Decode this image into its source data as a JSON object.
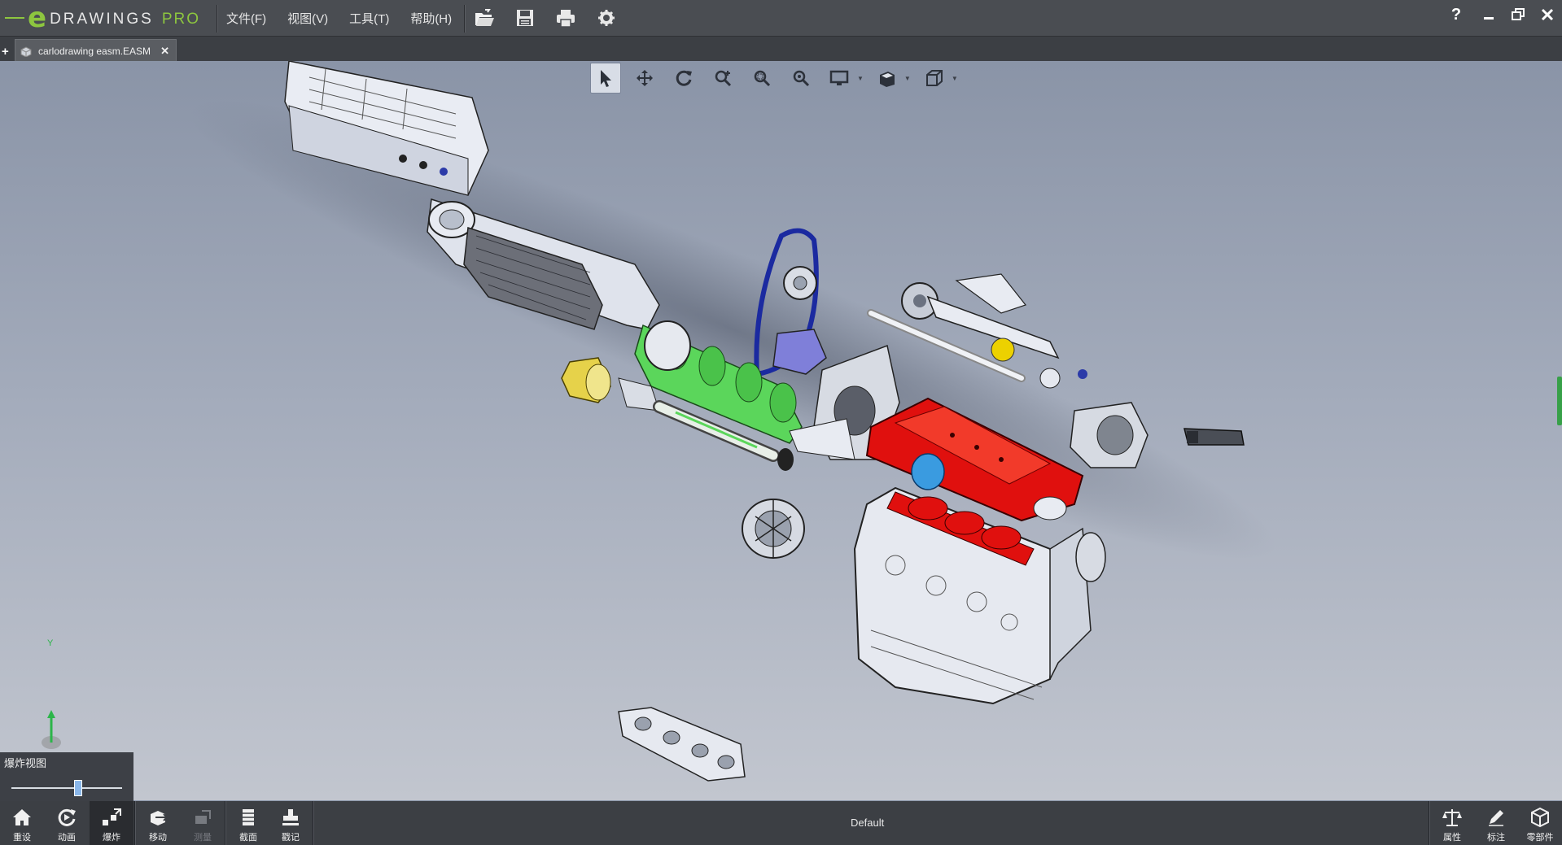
{
  "app": {
    "logo_text": "DRAWINGS",
    "logo_suffix": "PRO",
    "logo_e": "e"
  },
  "menu": {
    "items": [
      "文件(F)",
      "视图(V)",
      "工具(T)",
      "帮助(H)"
    ]
  },
  "toolbar": {
    "icons": [
      "open-folder-icon",
      "save-icon",
      "print-icon",
      "settings-gear-icon"
    ]
  },
  "window": {
    "help_label": "?"
  },
  "tabs": {
    "add_label": "+",
    "document": "carlodrawing easm.EASM",
    "close_label": "✕"
  },
  "viewport_tools": [
    "select",
    "pan",
    "rotate",
    "zoom-to-fit",
    "zoom-to-area",
    "zoom",
    "display-style",
    "shaded",
    "standard-views"
  ],
  "explode_panel": {
    "title": "爆炸视图",
    "level": 0.6
  },
  "axis": {
    "y_label": "Y"
  },
  "bottom": {
    "buttons": [
      {
        "label": "重设",
        "icon": "home-icon",
        "enabled": true
      },
      {
        "label": "动画",
        "icon": "animate-icon",
        "enabled": true
      },
      {
        "label": "爆炸",
        "icon": "explode-icon",
        "enabled": true,
        "active": true
      },
      {
        "label": "移动",
        "icon": "move-icon",
        "enabled": true
      },
      {
        "label": "测量",
        "icon": "measure-icon",
        "enabled": false
      },
      {
        "label": "截面",
        "icon": "section-icon",
        "enabled": true
      },
      {
        "label": "戳记",
        "icon": "stamp-icon",
        "enabled": true
      }
    ],
    "config_label": "Default",
    "right_buttons": [
      {
        "label": "属性",
        "icon": "properties-scale-icon"
      },
      {
        "label": "标注",
        "icon": "markup-pencil-icon"
      },
      {
        "label": "零部件",
        "icon": "components-icon"
      }
    ]
  },
  "colors": {
    "accent": "#8dc63f",
    "valve_cover": "#e0100e",
    "crankshaft": "#5bd65b",
    "timing_belt": "#1b2aa0"
  }
}
